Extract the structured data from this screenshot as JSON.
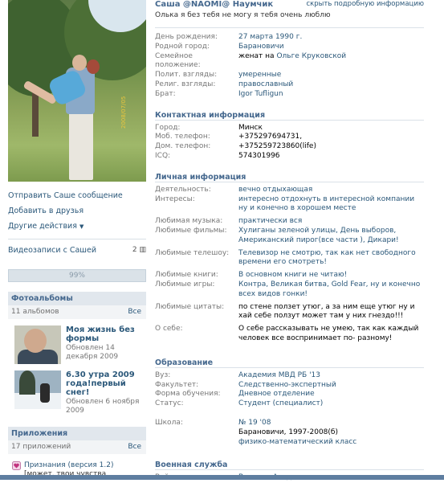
{
  "profile": {
    "name": "Саша @NAOMI@ Наумчик",
    "hide_link": "скрыть подробную информацию",
    "status": "Олька я без тебя не могу я тебя очень люблю"
  },
  "photo": {
    "stamp": "2008/07/05"
  },
  "left_actions": {
    "send_message": "Отправить Саше сообщение",
    "add_friend": "Добавить в друзья",
    "other_actions": "Другие действия"
  },
  "videos": {
    "label": "Видеозаписи с Сашей",
    "count": "2"
  },
  "rating": {
    "value": "99%",
    "fraction": 0.99
  },
  "albums": {
    "title": "Фотоальбомы",
    "count_label": "11 альбомов",
    "all_label": "Все",
    "items": [
      {
        "name": "Моя жизнь без формы",
        "updated": "Обновлен 14 декабря 2009"
      },
      {
        "name": "6.30 утра 2009 года!первый снег!",
        "updated": "Обновлен 6 ноября 2009"
      }
    ]
  },
  "apps": {
    "title": "Приложения",
    "count_label": "17 приложений",
    "all_label": "Все",
    "items": [
      {
        "name": "Признания (версия 1.2)",
        "desc": "[может, твои чувства"
      }
    ]
  },
  "basic": {
    "birthday": {
      "label": "День рождения:",
      "value": "27 марта 1990 г."
    },
    "hometown": {
      "label": "Родной город:",
      "value": "Барановичи"
    },
    "family": {
      "label": "Семейное положение:",
      "prefix": "женат на",
      "spouse": "Ольге Круковской"
    },
    "politics": {
      "label": "Полит. взгляды:",
      "value": "умеренные"
    },
    "religion": {
      "label": "Религ. взгляды:",
      "value": "православный"
    },
    "brother": {
      "label": "Брат:",
      "value": "Igor Tufligun"
    }
  },
  "contacts": {
    "title": "Контактная информация",
    "city": {
      "label": "Город:",
      "value": "Минск"
    },
    "mobile": {
      "label": "Моб. телефон:",
      "value": "+375297694731,"
    },
    "home": {
      "label": "Дом. телефон:",
      "value": "+375259723860(life)"
    },
    "icq": {
      "label": "ICQ:",
      "value": "574301996"
    }
  },
  "personal": {
    "title": "Личная информация",
    "activity": {
      "label": "Деятельность:",
      "value": "вечно отдыхающая"
    },
    "interests": {
      "label": "Интересы:",
      "value": "интересно отдохнуть в интересной компании ну и конечно в хорошем месте"
    },
    "music": {
      "label": "Любимая музыка:",
      "value": "практически вся"
    },
    "films": {
      "label": "Любимые фильмы:",
      "value": "Хулиганы зеленой улицы, День выборов, Американский пирог(все части ), Дикари!"
    },
    "tv": {
      "label": "Любимые телешоу:",
      "value": "Телевизор не смотрю, так как нет свободного времени его смотреть!"
    },
    "books": {
      "label": "Любимые книги:",
      "value": "В основном книги не читаю!"
    },
    "games": {
      "label": "Любимые игры:",
      "value": "Контра, Великая битва, Gold Fear, ну и конечно всех видов гонки!"
    },
    "quotes": {
      "label": "Любимые цитаты:",
      "value": "по стене ползет утюг, а за ним еще утюг ну и хай себе ползут может там у них гнездо!!!"
    },
    "about": {
      "label": "О себе:",
      "value": "О себе рассказывать не умею, так как каждый человек все воспринимает по- разному!"
    }
  },
  "education": {
    "title": "Образование",
    "university": {
      "label": "Вуз:",
      "value": "Академия МВД РБ '13"
    },
    "faculty": {
      "label": "Факультет:",
      "value": "Следственно-экспертный"
    },
    "form": {
      "label": "Форма обучения:",
      "value": "Дневное отделение"
    },
    "status": {
      "label": "Статус:",
      "value": "Студент (специалист)"
    },
    "school": {
      "label": "Школа:",
      "value": "№ 19 '08",
      "line2": "Барановичи, 1997-2008(б)",
      "line3": "физико-математический класс"
    }
  },
  "military": {
    "title": "Военная служба",
    "unit": {
      "label": "Войсковая часть:",
      "value": "Военная Академия"
    }
  },
  "colors": {
    "link": "#2b587a",
    "header": "#45688e",
    "label": "#777777"
  }
}
